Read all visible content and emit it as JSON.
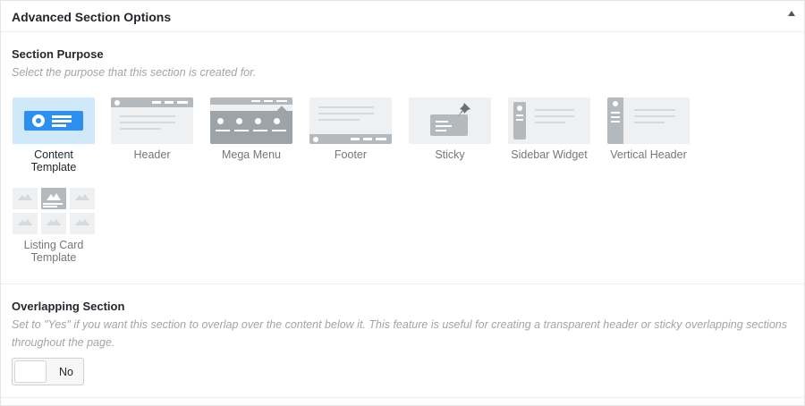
{
  "panel": {
    "title": "Advanced Section Options"
  },
  "section_purpose": {
    "title": "Section Purpose",
    "description": "Select the purpose that this section is created for.",
    "selected": "Content Template",
    "options": [
      {
        "label": "Content Template",
        "icon": "content-template-icon"
      },
      {
        "label": "Header",
        "icon": "header-layout-icon"
      },
      {
        "label": "Mega Menu",
        "icon": "mega-menu-layout-icon"
      },
      {
        "label": "Footer",
        "icon": "footer-layout-icon"
      },
      {
        "label": "Sticky",
        "icon": "sticky-pin-icon"
      },
      {
        "label": "Sidebar Widget",
        "icon": "sidebar-widget-layout-icon"
      },
      {
        "label": "Vertical Header",
        "icon": "vertical-header-layout-icon"
      },
      {
        "label": "Listing Card Template",
        "icon": "listing-card-grid-icon"
      }
    ]
  },
  "overlapping": {
    "title": "Overlapping Section",
    "description": "Set to \"Yes\" if you want this section to overlap over the content below it. This feature is useful for creating a transparent header or sticky overlapping sections throughout the page.",
    "value": "No"
  },
  "colors": {
    "selected_bg": "#cfe9fb",
    "accent_blue": "#2d8ff0",
    "thumb_gray": "#b4b9be",
    "thumb_bg": "#eef0f1"
  }
}
